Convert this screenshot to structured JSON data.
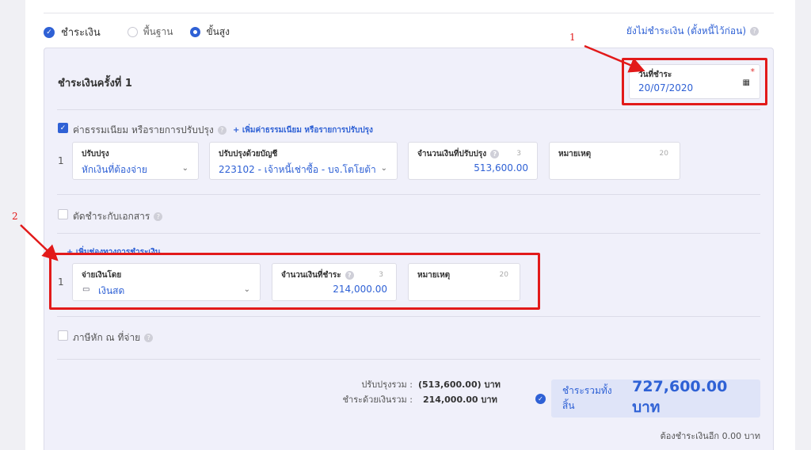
{
  "header": {
    "title": "ชำระเงิน",
    "mode_basic": "พื้นฐาน",
    "mode_advanced": "ขั้นสูง",
    "unpaid_link": "ยังไม่ชำระเงิน (ตั้งหนี้ไว้ก่อน)"
  },
  "panel": {
    "title": "ชำระเงินครั้งที่ 1",
    "date": {
      "label": "วันที่ชำระ",
      "value": "20/07/2020",
      "required_mark": "*"
    },
    "adjust_section": {
      "checkbox_label": "ค่าธรรมเนียม หรือรายการปรับปรุง",
      "add_link": "+ เพิ่มค่าธรรมเนียม หรือรายการปรับปรุง",
      "row_number": "1",
      "adjust": {
        "label": "ปรับปรุง",
        "value": "หักเงินที่ต้องจ่าย"
      },
      "account": {
        "label": "ปรับปรุงด้วยบัญชี",
        "value": "223102 - เจ้าหนี้เช่าซื้อ - บจ.โตโยต้า"
      },
      "amount": {
        "label": "จำนวนเงินที่ปรับปรุง",
        "count": "3",
        "value": "513,600.00"
      },
      "note": {
        "label": "หมายเหตุ",
        "count": "20"
      }
    },
    "offset_docs_label": "ตัดชำระกับเอกสาร",
    "payment_section": {
      "add_link": "+ เพิ่มช่องทางการชำระเงิน",
      "row_number": "1",
      "method": {
        "label": "จ่ายเงินโดย",
        "value": "เงินสด"
      },
      "amount": {
        "label": "จำนวนเงินที่ชำระ",
        "count": "3",
        "value": "214,000.00"
      },
      "note": {
        "label": "หมายเหตุ",
        "count": "20"
      }
    },
    "withholding_label": "ภาษีหัก ณ ที่จ่าย",
    "summary": {
      "adjust_total_label": "ปรับปรุงรวม :",
      "adjust_total_value": "(513,600.00) บาท",
      "paid_total_label": "ชำระด้วยเงินรวม :",
      "paid_total_value": "214,000.00 บาท",
      "grand_label": "ชำระรวมทั้งสิ้น",
      "grand_value": "727,600.00 บาท",
      "remaining": "ต้องชำระเงินอีก 0.00 บาท"
    }
  },
  "annotations": {
    "one": "1",
    "two": "2"
  },
  "colors": {
    "accent": "#2f61d5",
    "annotation": "#e21a1a",
    "panel_bg": "#f0f0fa"
  }
}
